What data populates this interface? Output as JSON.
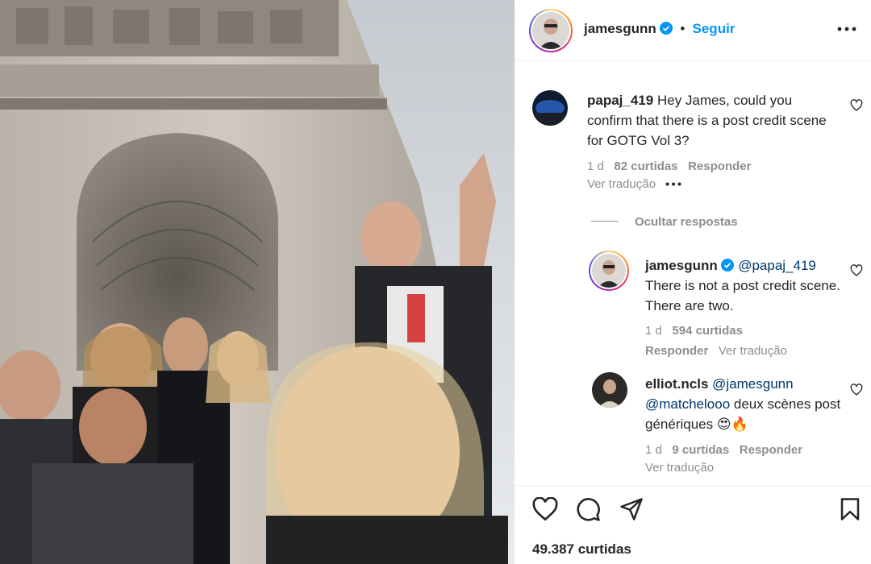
{
  "post": {
    "author": "jamesgunn",
    "follow_label": "Seguir",
    "more_icon": "more-options-icon",
    "likes_text": "49.387 curtidas"
  },
  "comments": [
    {
      "username": "papaj_419",
      "text": "Hey James, could you confirm that there is a post credit scene for GOTG Vol 3?",
      "time": "1 d",
      "likes": "82 curtidas",
      "reply_label": "Responder",
      "translate_label": "Ver tradução"
    }
  ],
  "replies_toggle": "Ocultar respostas",
  "replies": [
    {
      "username": "jamesgunn",
      "mention": "@papaj_419",
      "text": "There is not a post credit scene. There are two.",
      "time": "1 d",
      "likes": "594 curtidas",
      "reply_label": "Responder",
      "translate_label": "Ver tradução"
    },
    {
      "username": "elliot.ncls",
      "mention": "@jamesgunn",
      "mention2": "@matchelooo",
      "text": "deux scènes post génériques 😍🔥",
      "time": "1 d",
      "likes": "9 curtidas",
      "reply_label": "Responder",
      "translate_label": "Ver tradução"
    }
  ],
  "colors": {
    "accent": "#0095f6",
    "verified": "#0095f6",
    "secondary_text": "#8e8e8e",
    "mention": "#00376b"
  }
}
